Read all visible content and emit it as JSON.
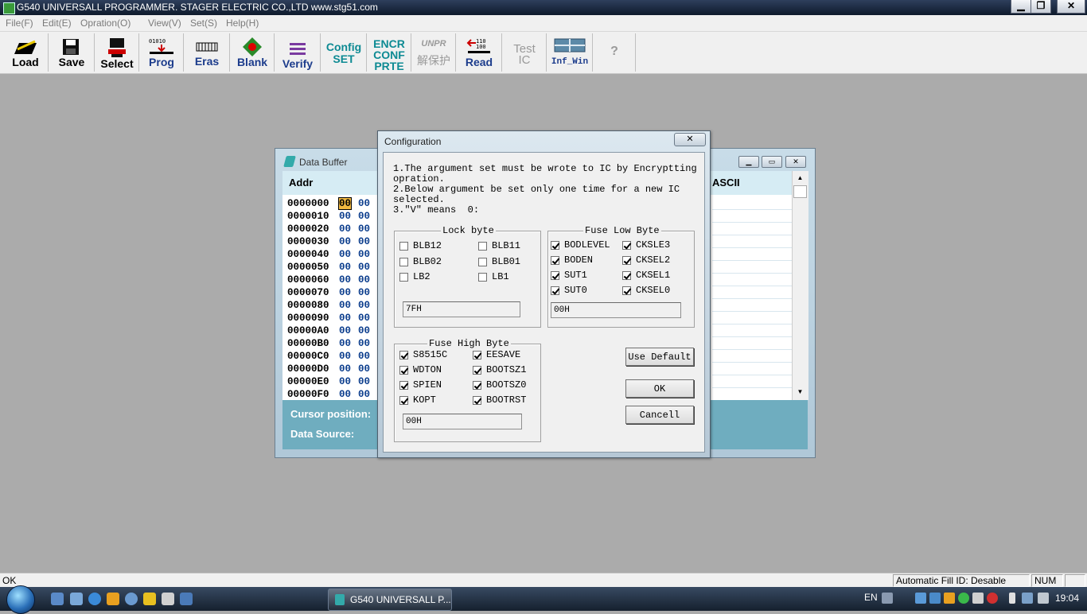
{
  "window": {
    "title": "G540 UNIVERSALL PROGRAMMER.  STAGER ELECTRIC CO.,LTD   www.stg51.com",
    "minimize": "▁",
    "restore": "❐",
    "close": "✕"
  },
  "menu": [
    "File(F)",
    "Edit(E)",
    "Opration(O)",
    "View(V)",
    "Set(S)",
    "Help(H)"
  ],
  "toolbar": {
    "load": "Load",
    "save": "Save",
    "select": "Select",
    "prog": "Prog",
    "eras": "Eras",
    "blank": "Blank",
    "verify": "Verify",
    "config_1": "Config",
    "config_2": "SET",
    "encr_1": "ENCR",
    "encr_2": "CONF",
    "encr_3": "PRTE",
    "unpr_1": "UNPR",
    "unpr_2": "解保护",
    "read": "Read",
    "test_1": "Test",
    "test_2": "IC",
    "infwin": "Inf_Win",
    "help": "?"
  },
  "data_buffer": {
    "title": "Data Buffer",
    "addr_header": "Addr",
    "ascii_header": "ASCII",
    "rows": [
      {
        "addr": "0000000",
        "b0": "00",
        "b1": "00"
      },
      {
        "addr": "0000010",
        "b0": "00",
        "b1": "00"
      },
      {
        "addr": "0000020",
        "b0": "00",
        "b1": "00"
      },
      {
        "addr": "0000030",
        "b0": "00",
        "b1": "00"
      },
      {
        "addr": "0000040",
        "b0": "00",
        "b1": "00"
      },
      {
        "addr": "0000050",
        "b0": "00",
        "b1": "00"
      },
      {
        "addr": "0000060",
        "b0": "00",
        "b1": "00"
      },
      {
        "addr": "0000070",
        "b0": "00",
        "b1": "00"
      },
      {
        "addr": "0000080",
        "b0": "00",
        "b1": "00"
      },
      {
        "addr": "0000090",
        "b0": "00",
        "b1": "00"
      },
      {
        "addr": "00000A0",
        "b0": "00",
        "b1": "00"
      },
      {
        "addr": "00000B0",
        "b0": "00",
        "b1": "00"
      },
      {
        "addr": "00000C0",
        "b0": "00",
        "b1": "00"
      },
      {
        "addr": "00000D0",
        "b0": "00",
        "b1": "00"
      },
      {
        "addr": "00000E0",
        "b0": "00",
        "b1": "00"
      },
      {
        "addr": "00000F0",
        "b0": "00",
        "b1": "00"
      }
    ],
    "cursor_position_label": "Cursor position:",
    "data_source_label": "Data Source:"
  },
  "config": {
    "title": "Configuration",
    "close": "✕",
    "note_1a": "1.The argument set must be wrote to IC by Encryptting",
    "note_1b": "opration.",
    "note_2a": "2.Below argument be set only one time for a new IC",
    "note_2b": "selected.",
    "note_3": "3.\"V\" means  0:",
    "lock": {
      "legend": "Lock byte",
      "items": [
        {
          "label": "BLB12",
          "checked": false
        },
        {
          "label": "BLB11",
          "checked": false
        },
        {
          "label": "BLB02",
          "checked": false
        },
        {
          "label": "BLB01",
          "checked": false
        },
        {
          "label": "LB2",
          "checked": false
        },
        {
          "label": "LB1",
          "checked": false
        }
      ],
      "value": "7FH"
    },
    "fuse_low": {
      "legend": "Fuse Low Byte",
      "items": [
        {
          "label": "BODLEVEL",
          "checked": true
        },
        {
          "label": "CKSLE3",
          "checked": true
        },
        {
          "label": "BODEN",
          "checked": true
        },
        {
          "label": "CKSEL2",
          "checked": true
        },
        {
          "label": "SUT1",
          "checked": true
        },
        {
          "label": "CKSEL1",
          "checked": true
        },
        {
          "label": "SUT0",
          "checked": true
        },
        {
          "label": "CKSEL0",
          "checked": true
        }
      ],
      "value": "00H"
    },
    "fuse_high": {
      "legend": "Fuse High Byte",
      "items": [
        {
          "label": "S8515C",
          "checked": true
        },
        {
          "label": "EESAVE",
          "checked": true
        },
        {
          "label": "WDTON",
          "checked": true
        },
        {
          "label": "BOOTSZ1",
          "checked": true
        },
        {
          "label": "SPIEN",
          "checked": true
        },
        {
          "label": "BOOTSZ0",
          "checked": true
        },
        {
          "label": "KOPT",
          "checked": true
        },
        {
          "label": "BOOTRST",
          "checked": true
        }
      ],
      "value": "00H"
    },
    "use_default": "Use Default",
    "ok": "OK",
    "cancel": "Cancell"
  },
  "statusbar": {
    "left": "OK",
    "fill_id": "Automatic Fill ID: Desable",
    "num": "NUM"
  },
  "taskbar": {
    "task": "G540 UNIVERSALL P...",
    "lang": "EN",
    "time": "19:04"
  }
}
